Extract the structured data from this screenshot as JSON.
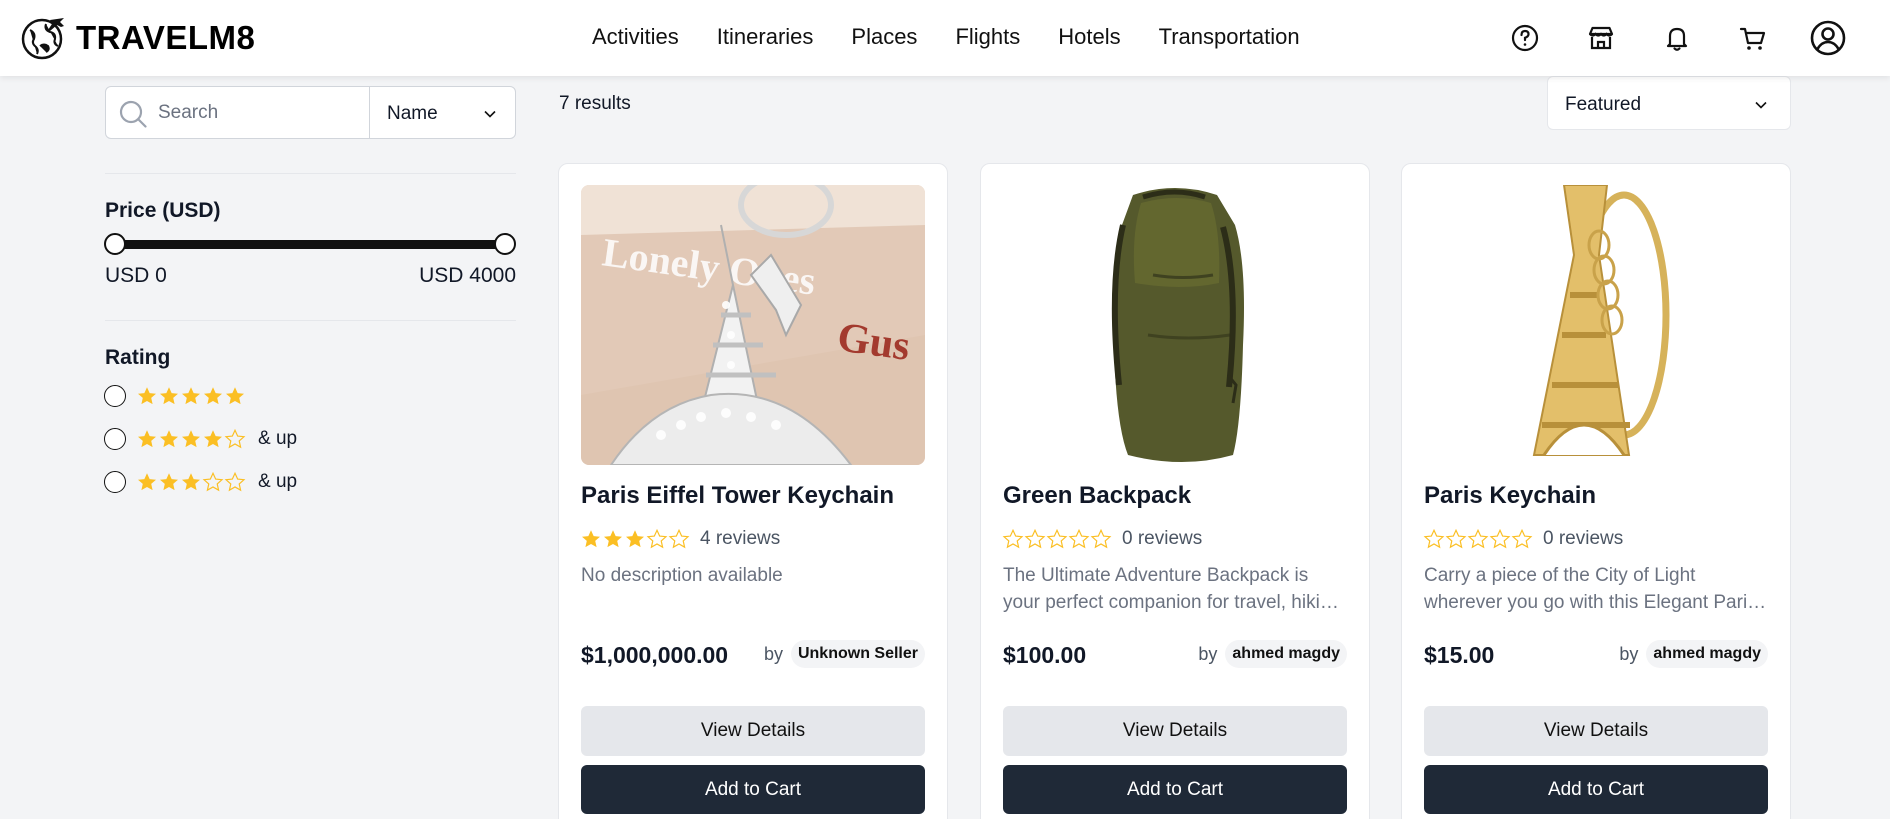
{
  "brand": {
    "name": "TRAVELM8",
    "logo_icon": "globe-airplane-icon"
  },
  "nav": [
    "Activities",
    "Itineraries",
    "Places",
    "Flights",
    "Hotels",
    "Transportation"
  ],
  "header_icons": [
    "help-icon",
    "store-icon",
    "bell-icon",
    "cart-icon",
    "user-icon"
  ],
  "search": {
    "placeholder": "Search",
    "value": ""
  },
  "sort_by": {
    "selected": "Name"
  },
  "filters": {
    "price": {
      "title": "Price (USD)",
      "min_label": "USD 0",
      "max_label": "USD 4000",
      "range": [
        0,
        4000
      ]
    },
    "rating": {
      "title": "Rating",
      "options": [
        {
          "stars": 5,
          "suffix": ""
        },
        {
          "stars": 4,
          "suffix": "& up"
        },
        {
          "stars": 3,
          "suffix": "& up"
        }
      ]
    }
  },
  "results": {
    "count_text": "7 results",
    "order": "Featured"
  },
  "products": [
    {
      "title": "Paris Eiffel Tower Keychain",
      "rating": 3,
      "reviews": "4 reviews",
      "description": "No description available",
      "price": "$1,000,000.00",
      "by": "by",
      "seller": "Unknown Seller",
      "view_label": "View Details",
      "cart_label": "Add to Cart"
    },
    {
      "title": "Green Backpack",
      "rating": 0,
      "reviews": "0 reviews",
      "description": "The Ultimate Adventure Backpack is your perfect companion for travel, hiking, and everyday adventures.",
      "price": "$100.00",
      "by": "by",
      "seller": "ahmed magdy",
      "view_label": "View Details",
      "cart_label": "Add to Cart"
    },
    {
      "title": "Paris Keychain",
      "rating": 0,
      "reviews": "0 reviews",
      "description": "Carry a piece of the City of Light wherever you go with this Elegant Paris keychain.",
      "price": "$15.00",
      "by": "by",
      "seller": "ahmed magdy",
      "view_label": "View Details",
      "cart_label": "Add to Cart"
    }
  ],
  "colors": {
    "star": "#fbbf24",
    "primary_button": "#1f2937",
    "secondary_button": "#e5e7eb",
    "page_bg": "#f3f4f6"
  },
  "image_text": {
    "book_line1": "Lonely Ones",
    "book_line2": "Gus"
  }
}
